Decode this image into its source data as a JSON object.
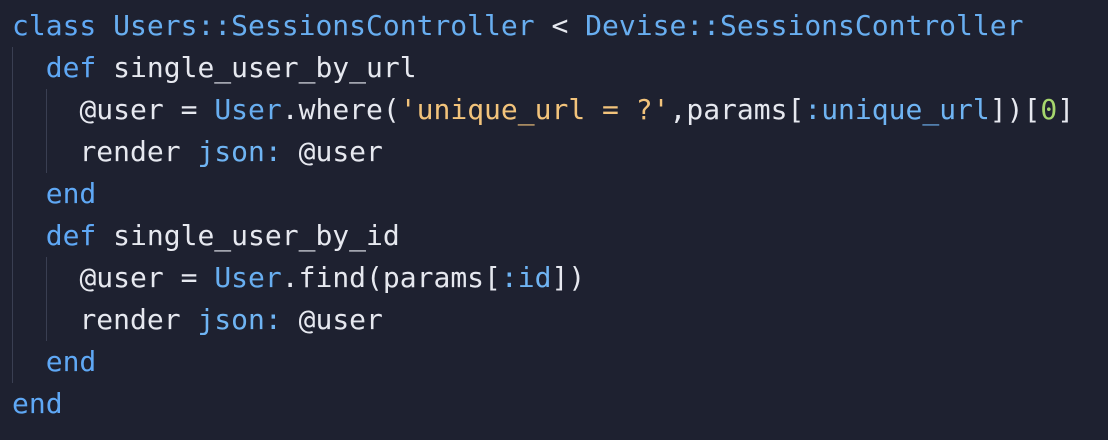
{
  "colors": {
    "background": "#1e2130",
    "plain": "#e6e8ef",
    "keyword": "#5fa8f5",
    "constant": "#68aef0",
    "string": "#f2c37b",
    "number": "#a6d66d",
    "symbol": "#6fb4f3"
  },
  "code": {
    "line1": {
      "kw_class": "class",
      "space1": " ",
      "class_name": "Users::SessionsController",
      "op": " < ",
      "parent_class": "Devise::SessionsController"
    },
    "line2": {
      "indent": "  ",
      "kw_def": "def",
      "method_name": " single_user_by_url"
    },
    "line3": {
      "indent": "    ",
      "ivar": "@user",
      "assign": " = ",
      "const": "User",
      "call": ".where(",
      "string": "'unique_url = ?'",
      "args1": ",params[",
      "symbol": ":unique_url",
      "args2": "])[",
      "number": "0",
      "close": "]"
    },
    "line4": {
      "indent": "    ",
      "method": "render",
      "space": " ",
      "key": "json:",
      "value": " @user"
    },
    "line5": {
      "indent": "  ",
      "kw_end": "end"
    },
    "line6": {
      "indent": "  ",
      "kw_def": "def",
      "method_name": " single_user_by_id"
    },
    "line7": {
      "indent": "    ",
      "ivar": "@user",
      "assign": " = ",
      "const": "User",
      "call": ".find(params[",
      "symbol": ":id",
      "close": "])"
    },
    "line8": {
      "indent": "    ",
      "method": "render",
      "space": " ",
      "key": "json:",
      "value": " @user"
    },
    "line9": {
      "indent": "  ",
      "kw_end": "end"
    },
    "line10": {
      "kw_end": "end"
    }
  }
}
